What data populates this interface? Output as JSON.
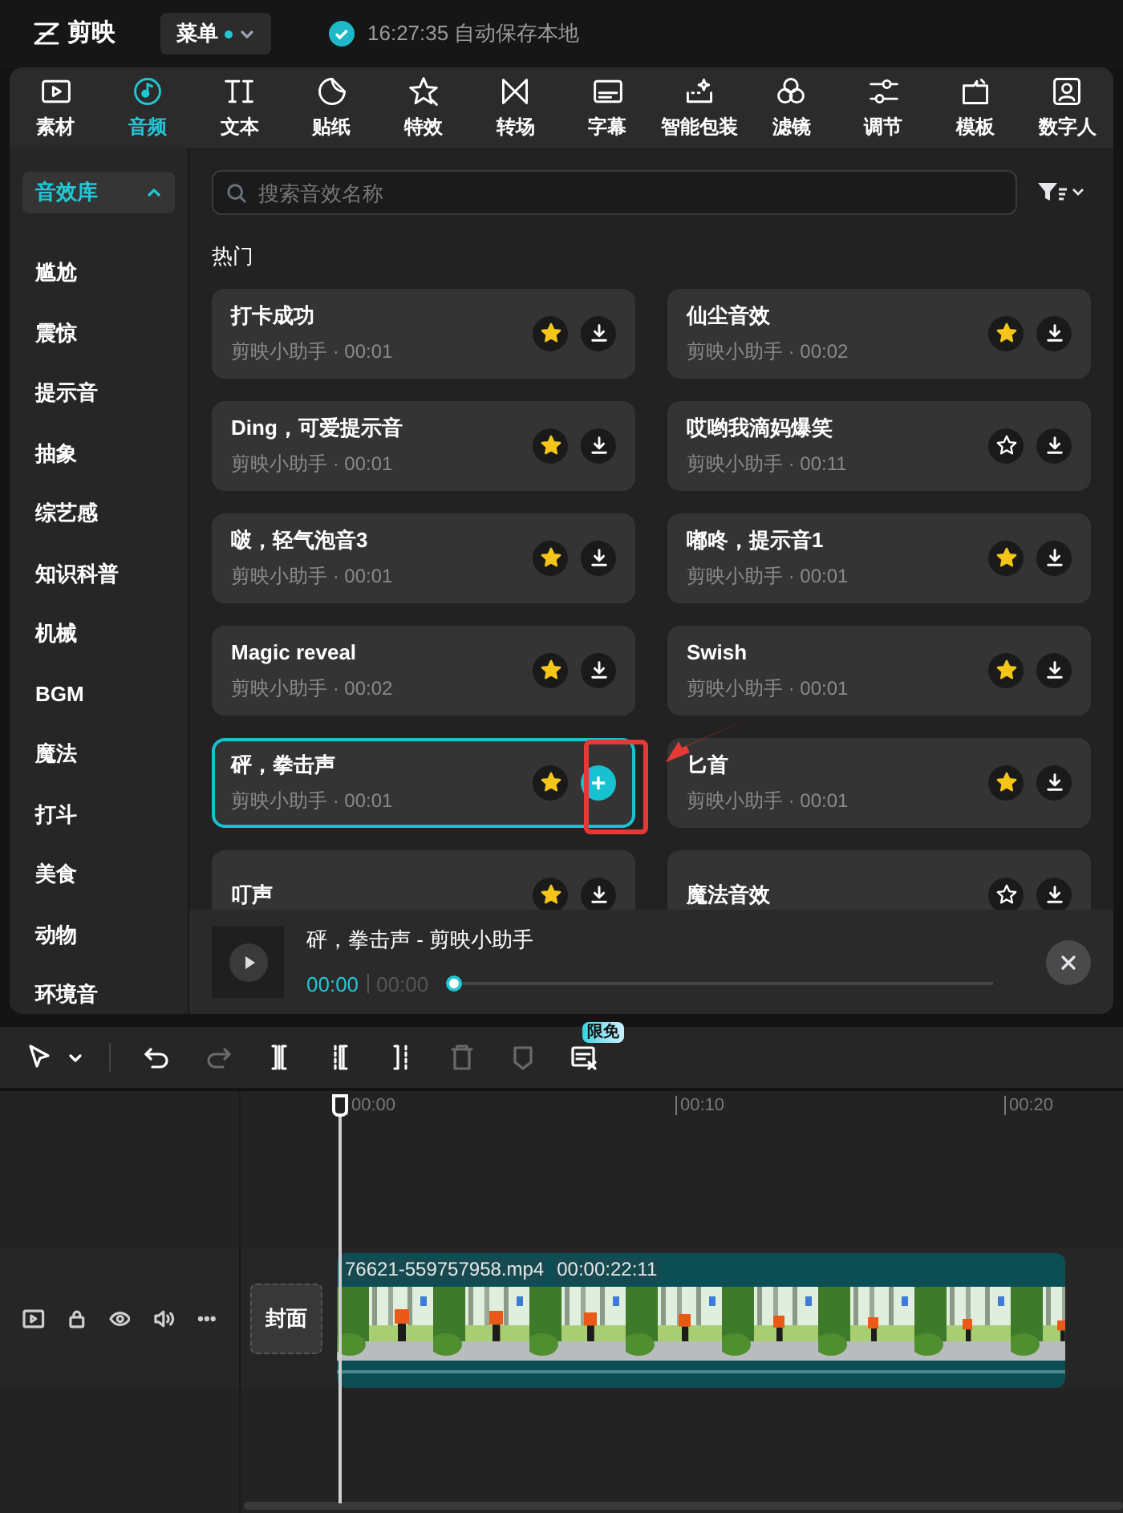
{
  "app": {
    "name": "剪映",
    "menu": "菜单",
    "menu_dot": true,
    "save_status": "16:27:35 自动保存本地"
  },
  "tabs": [
    {
      "kind": "media",
      "label": "素材",
      "selected": false
    },
    {
      "kind": "audio",
      "label": "音频",
      "selected": true
    },
    {
      "kind": "text",
      "label": "文本",
      "selected": false
    },
    {
      "kind": "sticker",
      "label": "贴纸",
      "selected": false
    },
    {
      "kind": "effect",
      "label": "特效",
      "selected": false
    },
    {
      "kind": "transition",
      "label": "转场",
      "selected": false
    },
    {
      "kind": "caption",
      "label": "字幕",
      "selected": false
    },
    {
      "kind": "smart",
      "label": "智能包装",
      "selected": false
    },
    {
      "kind": "filter",
      "label": "滤镜",
      "selected": false
    },
    {
      "kind": "adjust",
      "label": "调节",
      "selected": false
    },
    {
      "kind": "template",
      "label": "模板",
      "selected": false
    },
    {
      "kind": "avatar",
      "label": "数字人",
      "selected": false
    }
  ],
  "sidebar": {
    "header": "音效库",
    "expanded": true,
    "items": [
      {
        "label": "尴尬"
      },
      {
        "label": "震惊"
      },
      {
        "label": "提示音"
      },
      {
        "label": "抽象"
      },
      {
        "label": "综艺感"
      },
      {
        "label": "知识科普"
      },
      {
        "label": "机械"
      },
      {
        "label": "BGM"
      },
      {
        "label": "魔法"
      },
      {
        "label": "打斗"
      },
      {
        "label": "美食"
      },
      {
        "label": "动物"
      },
      {
        "label": "环境音"
      }
    ]
  },
  "search": {
    "placeholder": "搜索音效名称"
  },
  "section_title": "热门",
  "sounds": [
    {
      "title": "打卡成功",
      "subtitle": "剪映小助手 · 00:01",
      "favorite": true,
      "selected": false
    },
    {
      "title": "仙尘音效",
      "subtitle": "剪映小助手 · 00:02",
      "favorite": true,
      "selected": false
    },
    {
      "title": "Ding，可爱提示音",
      "subtitle": "剪映小助手 · 00:01",
      "favorite": true,
      "selected": false
    },
    {
      "title": "哎哟我滴妈爆笑",
      "subtitle": "剪映小助手 · 00:11",
      "favorite": false,
      "selected": false
    },
    {
      "title": "啵，轻气泡音3",
      "subtitle": "剪映小助手 · 00:01",
      "favorite": true,
      "selected": false
    },
    {
      "title": "嘟咚，提示音1",
      "subtitle": "剪映小助手 · 00:01",
      "favorite": true,
      "selected": false
    },
    {
      "title": "Magic reveal",
      "subtitle": "剪映小助手 · 00:02",
      "favorite": true,
      "selected": false
    },
    {
      "title": "Swish",
      "subtitle": "剪映小助手 · 00:01",
      "favorite": true,
      "selected": false
    },
    {
      "title": "砰，拳击声",
      "subtitle": "剪映小助手 · 00:01",
      "favorite": true,
      "selected": true
    },
    {
      "title": "匕首",
      "subtitle": "剪映小助手 · 00:01",
      "favorite": true,
      "selected": false
    },
    {
      "title": "叮声",
      "favorite": true,
      "selected": false
    },
    {
      "title": "魔法音效",
      "favorite": false,
      "selected": false
    }
  ],
  "player": {
    "title": "砰，拳击声 - 剪映小助手",
    "current": "00:00",
    "duration": "00:00",
    "level": 0
  },
  "annotations": [
    {
      "kind": "box"
    },
    {
      "kind": "arrow"
    }
  ],
  "timeline_tools": [
    {
      "kind": "select"
    },
    {
      "kind": "undo",
      "disabled": false
    },
    {
      "kind": "redo",
      "disabled": true
    },
    {
      "kind": "split",
      "disabled": false
    },
    {
      "kind": "trim-left",
      "disabled": false
    },
    {
      "kind": "trim-right",
      "disabled": false
    },
    {
      "kind": "delete",
      "disabled": true
    },
    {
      "kind": "mark",
      "disabled": true
    },
    {
      "kind": "caption-remove",
      "disabled": false,
      "badge": "限免"
    }
  ],
  "ruler": [
    "00:00",
    "00:10",
    "00:20"
  ],
  "track": {
    "cover": "封面",
    "clip": {
      "file": "76621-559757958.mp4",
      "duration": "00:00:22:11"
    }
  }
}
